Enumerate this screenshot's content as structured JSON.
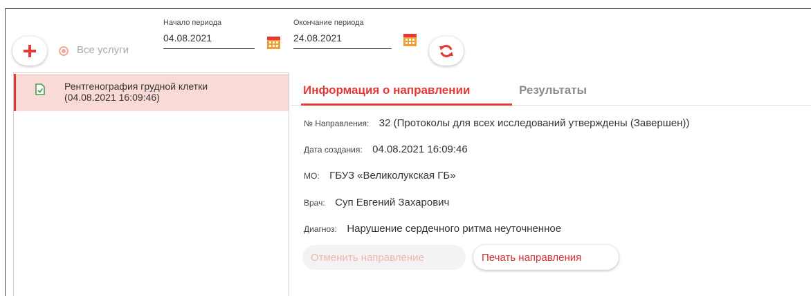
{
  "toolbar": {
    "add_icon": "plus-icon",
    "all_services_label": "Все услуги",
    "period_start_label": "Начало периода",
    "period_start_value": "04.08.2021",
    "period_end_label": "Окончание периода",
    "period_end_value": "24.08.2021",
    "refresh_icon": "refresh-icon",
    "accent_color": "#e53935"
  },
  "list": {
    "items": [
      {
        "title": "Рентгенография грудной клетки",
        "datetime": "(04.08.2021 16:09:46)",
        "selected": true
      }
    ]
  },
  "tabs": {
    "info": "Информация о направлении",
    "results": "Результаты",
    "active": "info"
  },
  "details": {
    "referral_number_key": "№ Направления:",
    "referral_number_value": "32 (Протоколы для всех исследований утверждены (Завершен))",
    "created_key": "Дата создания:",
    "created_value": "04.08.2021 16:09:46",
    "mo_key": "МО:",
    "mo_value": "ГБУЗ «Великолукская ГБ»",
    "doctor_key": "Врач:",
    "doctor_value": "Суп Евгений Захарович",
    "diagnosis_key": "Диагноз:",
    "diagnosis_value": "Нарушение сердечного ритма неуточненное"
  },
  "actions": {
    "cancel_label": "Отменить направление",
    "print_label": "Печать направления"
  }
}
